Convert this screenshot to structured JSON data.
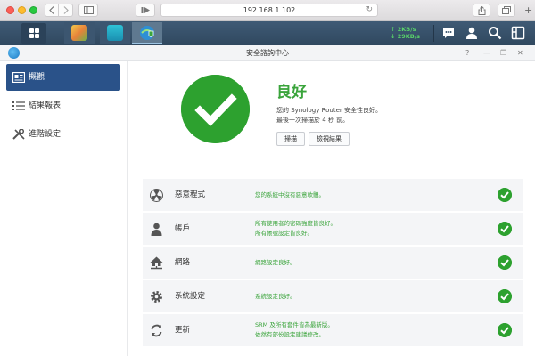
{
  "browser": {
    "url": "192.168.1.102"
  },
  "taskbar": {
    "upload_speed": "2KB/s",
    "download_speed": "29KB/s"
  },
  "window": {
    "title": "安全諮詢中心"
  },
  "nav": {
    "items": [
      {
        "label": "概觀",
        "icon": "overview-card-icon",
        "active": true
      },
      {
        "label": "結果報表",
        "icon": "list-icon",
        "active": false
      },
      {
        "label": "進階設定",
        "icon": "tools-icon",
        "active": false
      }
    ]
  },
  "status": {
    "title": "良好",
    "line1": "您的 Synology Router 安全性良好。",
    "line2": "最後一次掃描於 4 秒 前。",
    "scan_label": "掃描",
    "view_results_label": "檢視結果"
  },
  "checks": [
    {
      "name": "惡意程式",
      "icon": "radiation-icon",
      "desc": [
        "您的系統中沒有惡意軟體。"
      ]
    },
    {
      "name": "帳戶",
      "icon": "user-icon",
      "desc": [
        "所有使用者的密碼強度皆良好。",
        "所有帳號設定皆良好。"
      ]
    },
    {
      "name": "網路",
      "icon": "house-network-icon",
      "desc": [
        "網路設定良好。"
      ]
    },
    {
      "name": "系統設定",
      "icon": "gear-icon",
      "desc": [
        "系統設定良好。"
      ]
    },
    {
      "name": "更新",
      "icon": "refresh-icon",
      "desc": [
        "SRM 及所有套件皆為最新版。",
        "依然有部份設定建議修改。"
      ]
    }
  ],
  "colors": {
    "accent_green": "#2da12f",
    "nav_active": "#2a5289",
    "taskbar": "#34506a"
  }
}
